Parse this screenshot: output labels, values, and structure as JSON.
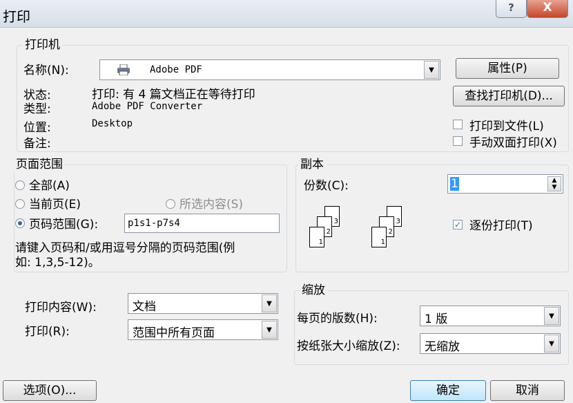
{
  "window": {
    "title": "打印",
    "help_glyph": "?",
    "close_glyph": "X"
  },
  "printer": {
    "legend": "打印机",
    "name_label": "名称(N):",
    "name_value": "Adobe PDF",
    "properties_button": "属性(P)",
    "status_label": "状态:",
    "status_value": "打印: 有 4 篇文档正在等待打印",
    "type_label": "类型:",
    "type_value": "Adobe PDF Converter",
    "where_label": "位置:",
    "where_value": "Desktop",
    "comment_label": "备注:",
    "find_printer_button": "查找打印机(D)...",
    "print_to_file_label": "打印到文件(L)",
    "manual_duplex_label": "手动双面打印(X)"
  },
  "page_range": {
    "legend": "页面范围",
    "all_label": "全部(A)",
    "current_label": "当前页(E)",
    "selection_label": "所选内容(S)",
    "pages_label": "页码范围(G):",
    "pages_value": "p1s1-p7s4",
    "hint_line1": "请键入页码和/或用逗号分隔的页码范围(例",
    "hint_line2": "如: 1,3,5-12)。"
  },
  "copies": {
    "legend": "副本",
    "count_label": "份数(C):",
    "count_value": "1",
    "collate_label": "逐份打印(T)",
    "page_numbers": [
      "1",
      "2",
      "3"
    ]
  },
  "print_what": {
    "what_label": "打印内容(W):",
    "what_value": "文档",
    "print_label": "打印(R):",
    "print_value": "范围中所有页面"
  },
  "zoom": {
    "legend": "缩放",
    "pages_per_sheet_label": "每页的版数(H):",
    "pages_per_sheet_value": "1 版",
    "scale_label": "按纸张大小缩放(Z):",
    "scale_value": "无缩放"
  },
  "footer": {
    "options_button": "选项(O)...",
    "ok_button": "确定",
    "cancel_button": "取消"
  }
}
